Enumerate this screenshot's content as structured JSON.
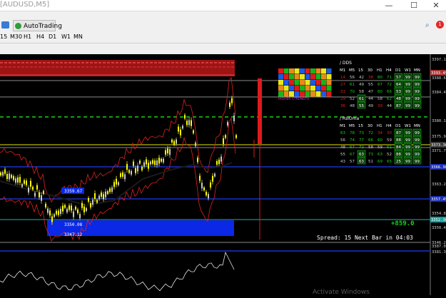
{
  "window": {
    "title": "[AUDUSD,M5]",
    "minimize": "—",
    "maximize": "☐",
    "close": "✕"
  },
  "toolbar": {
    "autotrading_label": "AutoTrading",
    "timeframes": [
      "15",
      "M30",
      "H1",
      "H4",
      "D1",
      "W1",
      "MN"
    ]
  },
  "notif_badge": "1",
  "chart": {
    "price_ticks": [
      "3397.10",
      "3388.60",
      "3384.40",
      "3380.10",
      "3375.90",
      "3371.70",
      "3367.40",
      "3363.20",
      "3358.90",
      "3354.80",
      "3350.40",
      "3346.20"
    ],
    "price_tags": [
      {
        "label": "3393.49",
        "color": "#a63232"
      },
      {
        "label": "3373.36",
        "color": "#3c3c3c"
      },
      {
        "label": "3366.90",
        "color": "#1c2fb5"
      },
      {
        "label": "3357.49",
        "color": "#1c2fb5"
      },
      {
        "label": "3352.36",
        "color": "#14a09e"
      }
    ],
    "level_labels": [
      "3359.67",
      "3350.08",
      "3347.12"
    ],
    "pl_text": "+859.0",
    "status_text": "Spread: 15  Next Bar in 04:03",
    "dds_title": "/ DDS",
    "rsi_title": "/ RsiOma",
    "tf_headers": [
      "M1",
      "M5",
      "15",
      "30",
      "H1",
      "H4",
      "D1",
      "W1",
      "MN"
    ],
    "dds_rows": [
      [
        "14",
        "56",
        "42",
        "38",
        "80",
        "71",
        "57",
        "99",
        "99"
      ],
      [
        "27",
        "61",
        "49",
        "55",
        "67",
        "72",
        "64",
        "99",
        "99"
      ],
      [
        "33",
        "70",
        "58",
        "47",
        "80",
        "66",
        "53",
        "99",
        "99"
      ],
      [
        "29",
        "52",
        "61",
        "44",
        "58",
        "62",
        "48",
        "99",
        "99"
      ],
      [
        "36",
        "48",
        "55",
        "49",
        "39",
        "44",
        "87",
        "99",
        "99"
      ]
    ],
    "rsi_rows": [
      [
        "63",
        "78",
        "73",
        "72",
        "34",
        "30",
        "87",
        "99",
        "99"
      ],
      [
        "56",
        "74",
        "77",
        "66",
        "60",
        "59",
        "88",
        "99",
        "99"
      ],
      [
        "48",
        "67",
        "72",
        "58",
        "59",
        "61",
        "84",
        "99",
        "99"
      ],
      [
        "55",
        "67",
        "63",
        "73",
        "63",
        "52",
        "88",
        "99",
        "99"
      ],
      [
        "43",
        "57",
        "63",
        "51",
        "69",
        "65",
        "25",
        "99",
        "99"
      ]
    ],
    "heat_label": "HIGHER STRENGTH",
    "osc_ticks": [
      "3387.03",
      "3381.31"
    ],
    "watermark": "Activate Windows"
  },
  "colors": {
    "bull": "#ffff00",
    "bear": "#c8c8c8",
    "band": "#e02020",
    "ma": "#000000",
    "blue_line": "#1a30c8",
    "green_dash": "#19d219",
    "yellow_line": "#e6e600"
  }
}
